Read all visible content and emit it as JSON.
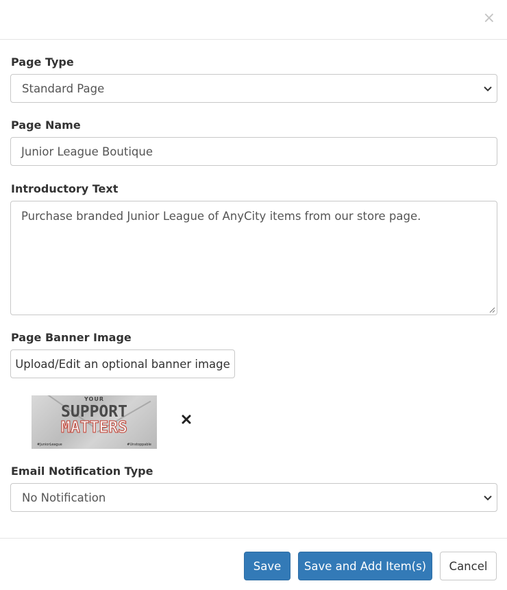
{
  "header": {
    "close_label": "×"
  },
  "form": {
    "page_type": {
      "label": "Page Type",
      "selected": "Standard Page"
    },
    "page_name": {
      "label": "Page Name",
      "value": "Junior League Boutique"
    },
    "intro_text": {
      "label": "Introductory Text",
      "value": "Purchase branded Junior League of AnyCity items from our store page."
    },
    "banner": {
      "label": "Page Banner Image",
      "upload_label": "Upload/Edit an optional banner image",
      "image_text": {
        "top": "YOUR",
        "line1": "SUPPORT",
        "line2": "MATTERS",
        "tag_left": "#JuniorLeague",
        "tag_right": "#Unstoppable"
      }
    },
    "email_notification": {
      "label": "Email Notification Type",
      "selected": "No Notification"
    }
  },
  "footer": {
    "save_label": "Save",
    "save_add_label": "Save and Add Item(s)",
    "cancel_label": "Cancel"
  },
  "colors": {
    "primary": "#337ab7",
    "border": "#c8c8c8",
    "text": "#333333"
  }
}
